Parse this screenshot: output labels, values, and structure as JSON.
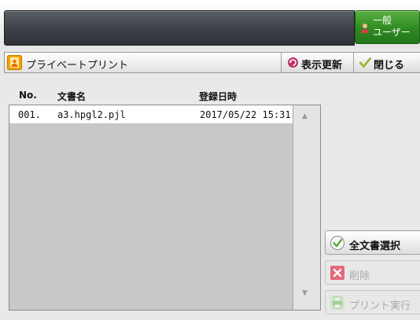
{
  "header": {
    "user_label_line1": "一般",
    "user_label_line2": "ユーザー"
  },
  "panel": {
    "title": "プライベートプリント",
    "refresh_label": "表示更新",
    "close_label": "閉じる"
  },
  "table": {
    "columns": {
      "no": "No.",
      "name": "文書名",
      "date": "登録日時"
    },
    "rows": [
      {
        "no": "001.",
        "name": "a3.hpgl2.pjl",
        "date": "2017/05/22 15:31"
      }
    ]
  },
  "actions": {
    "select_all": "全文書選択",
    "delete": "削除",
    "print": "プリント実行"
  },
  "colors": {
    "user_button": "#2f8a22",
    "delete_icon": "#e46a7a",
    "accent_orange": "#f5a000"
  }
}
